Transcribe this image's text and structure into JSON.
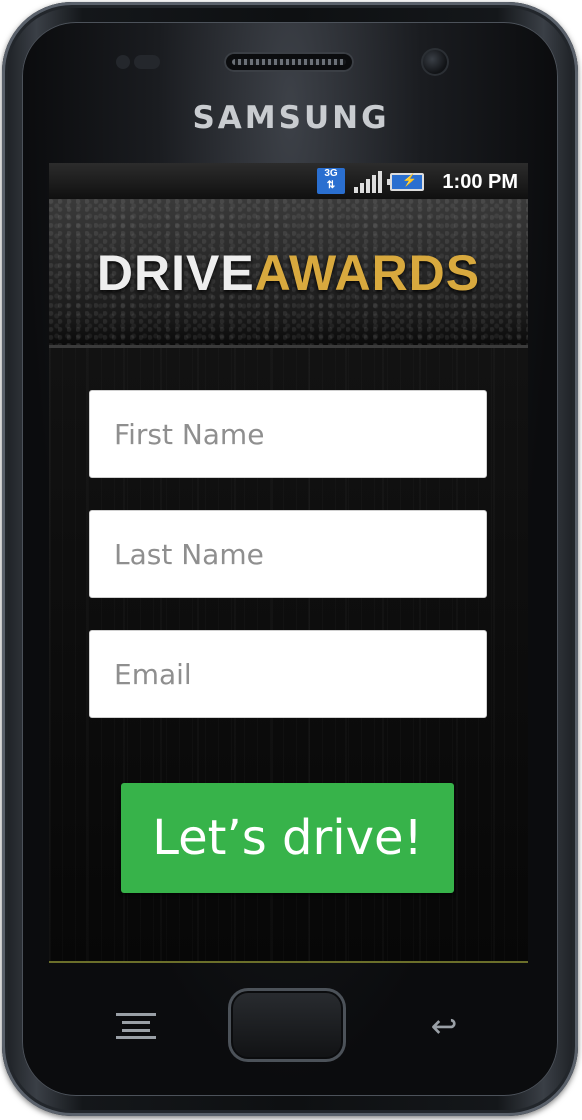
{
  "device": {
    "brand": "SAMSUNG"
  },
  "statusbar": {
    "network_icon": "3g-data-icon",
    "network_label": "3G",
    "signal_icon": "signal-bars-icon",
    "battery_icon": "battery-charging-icon",
    "time": "1:00 PM"
  },
  "banner": {
    "logo_part1": "DRIVE",
    "logo_part2": "AWARDS"
  },
  "form": {
    "first_name": {
      "value": "",
      "placeholder": "First Name"
    },
    "last_name": {
      "value": "",
      "placeholder": "Last Name"
    },
    "email": {
      "value": "",
      "placeholder": "Email"
    },
    "submit_label": "Let’s drive!"
  },
  "hardware_keys": {
    "menu": "menu-icon",
    "home": "home-button",
    "back": "back-arrow-icon"
  },
  "colors": {
    "button_green": "#37b34a",
    "logo_gold": "#d8a93e",
    "statusbar_blue": "#2a6fd0"
  }
}
